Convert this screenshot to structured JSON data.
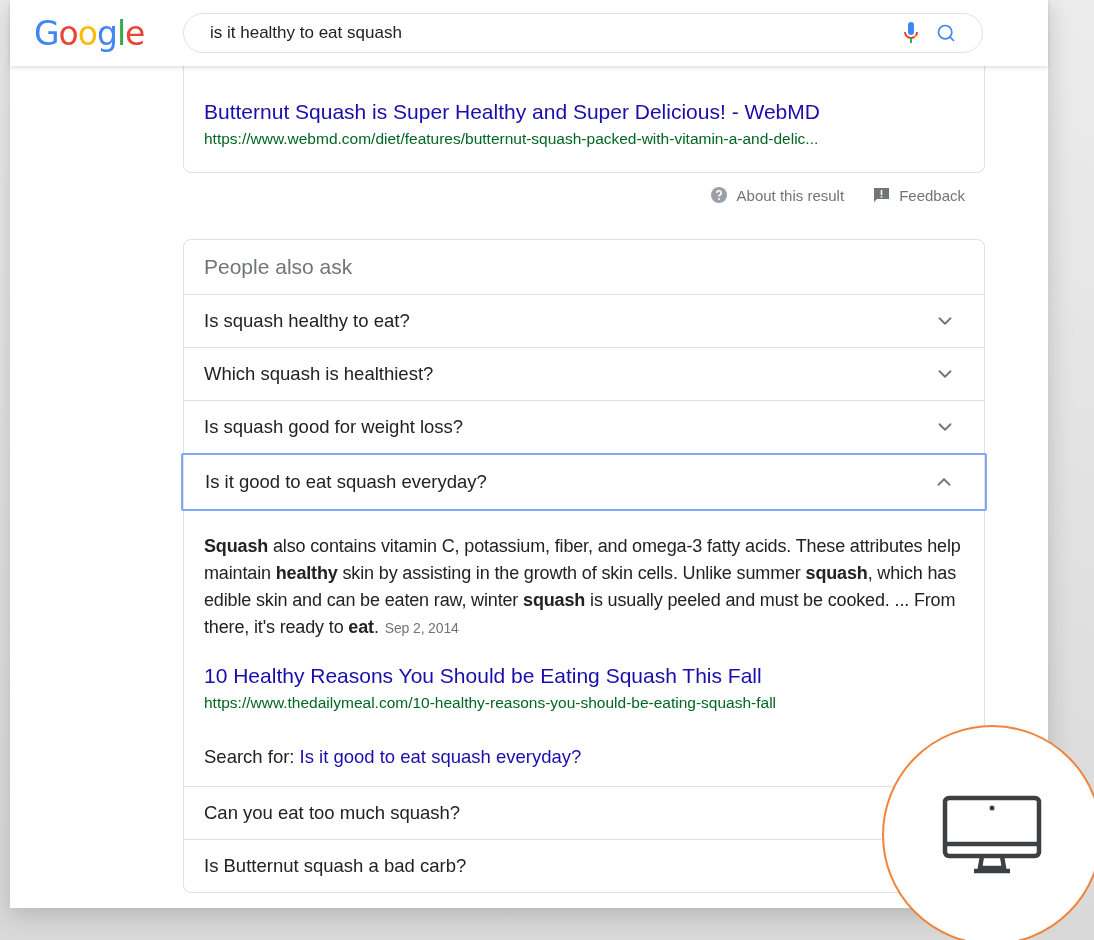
{
  "header": {
    "logo": "Google",
    "query": "is it healthy to eat squash"
  },
  "result": {
    "title": "Butternut Squash is Super Healthy and Super Delicious! - WebMD",
    "url": "https://www.webmd.com/diet/features/butternut-squash-packed-with-vitamin-a-and-delic..."
  },
  "result_actions": [
    "About this result",
    "Feedback"
  ],
  "people_also_ask": {
    "title": "People also ask",
    "questions": [
      {
        "text": "Is squash healthy to eat?",
        "expanded": false
      },
      {
        "text": "Which squash is healthiest?",
        "expanded": false
      },
      {
        "text": "Is squash good for weight loss?",
        "expanded": false
      },
      {
        "text": "Is it good to eat squash everyday?",
        "expanded": true,
        "answer": {
          "snippet": "**Squash** also contains vitamin C, potassium, fiber, and omega-3 fatty acids. These attributes help maintain **healthy** skin by assisting in the growth of skin cells. Unlike summer **squash**, which has edible skin and can be eaten raw, winter **squash** is usually peeled and must be cooked. ... From there, it's ready to **eat**.",
          "date": "Sep 2, 2014",
          "link_title": "10 Healthy Reasons You Should be Eating Squash This Fall",
          "link_url": "https://www.thedailymeal.com/10-healthy-reasons-you-should-be-eating-squash-fall",
          "search_label": "Search for:",
          "search_query": "Is it good to eat squash everyday?"
        }
      },
      {
        "text": "Can you eat too much squash?",
        "expanded": false
      },
      {
        "text": "Is Butternut squash a bad carb?",
        "expanded": false
      }
    ]
  }
}
